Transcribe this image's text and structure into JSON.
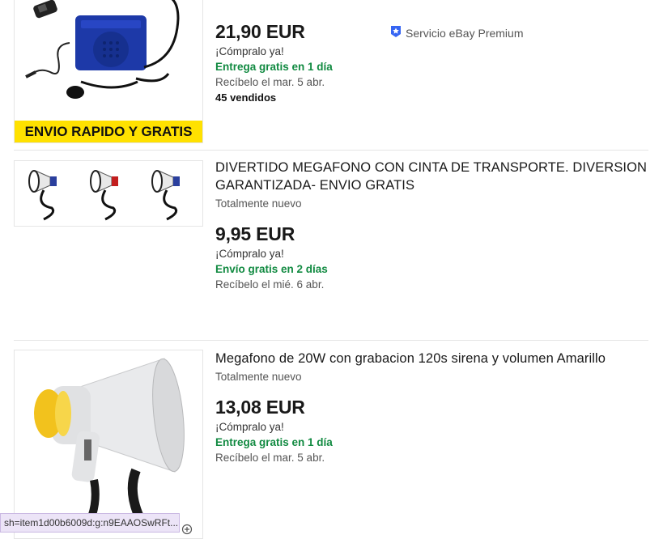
{
  "listings": [
    {
      "title": "",
      "banner": "ENVIO RAPIDO Y GRATIS",
      "condition": "",
      "price": "21,90 EUR",
      "buy_now": "¡Cómpralo ya!",
      "shipping": "Entrega gratis en 1 día",
      "delivery": "Recíbelo el mar. 5 abr.",
      "sold": "45 vendidos",
      "badge": "Servicio eBay Premium",
      "badge_icon": "ebay-premium-badge-icon"
    },
    {
      "title": "DIVERTIDO MEGAFONO CON CINTA DE TRANSPORTE. DIVERSION GARANTIZADA- ENVIO GRATIS",
      "condition": "Totalmente nuevo",
      "price": "9,95 EUR",
      "buy_now": "¡Cómpralo ya!",
      "shipping": "Envío gratis en 2 días",
      "delivery": "Recíbelo el mié. 6 abr."
    },
    {
      "title": "Megafono de 20W con grabacion 120s sirena y volumen Amarillo",
      "condition": "Totalmente nuevo",
      "price": "13,08 EUR",
      "buy_now": "¡Cómpralo ya!",
      "shipping": "Entrega gratis en 1 día",
      "delivery": "Recíbelo el mar. 5 abr."
    }
  ],
  "status_bar": {
    "url": "sh=item1d00b6009d:g:n9EAAOSwRFt..."
  },
  "colors": {
    "shipping_green": "#118a41",
    "badge_blue": "#3665f3",
    "banner_yellow": "#ffe100",
    "status_bg": "#ece4f7"
  }
}
